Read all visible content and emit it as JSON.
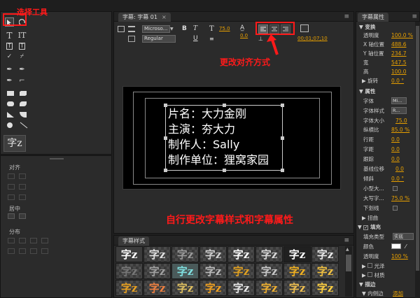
{
  "annotations": {
    "select_tool": "选择工具",
    "align_mode": "更改对齐方式",
    "style_hint": "自行更改字幕样式和字幕属性"
  },
  "title_panel": {
    "tab_label": "字幕: 字幕 01",
    "font_family": "Microso...",
    "font_style": "Regular",
    "font_size": "75.0",
    "kerning": "0.0",
    "timecode": "00;01;07;10",
    "caption_lines": [
      "片名：大力金刚",
      "主演：夯大力",
      "制作人：Sally",
      "制作单位：狸窝家园"
    ]
  },
  "tools_panel": {
    "type_tool_preview": "字z",
    "align_label": "对齐",
    "center_label": "居中",
    "distribute_label": "分布"
  },
  "styles_panel": {
    "tab_label": "字幕样式",
    "thumb_glyph": "字z"
  },
  "properties_panel": {
    "tab_label": "字幕属性",
    "transform_header": "变换",
    "opacity_label": "透明度",
    "opacity_value": "100.0 %",
    "x_label": "X 轴位置",
    "x_value": "488.6",
    "y_label": "Y 轴位置",
    "y_value": "234.7",
    "width_label": "宽",
    "width_value": "547.5",
    "height_label": "高",
    "height_value": "100.0",
    "rotation_label": "旋转",
    "rotation_value": "0.0 °",
    "attributes_header": "属性",
    "font_label": "字体",
    "font_value": "Mi...",
    "font_style_label": "字体样式",
    "font_style_value": "R...",
    "font_size_label": "字体大小",
    "font_size_value": "75.0",
    "aspect_label": "纵横比",
    "aspect_value": "85.0 %",
    "leading_label": "行距",
    "leading_value": "0.0",
    "kerning_label": "字距",
    "kerning_value": "0.0",
    "tracking_label": "跟踪",
    "tracking_value": "0.0",
    "baseline_label": "基线位移",
    "baseline_value": "0.0",
    "slant_label": "倾斜",
    "slant_value": "0.0 °",
    "smallcaps_label": "小型大...",
    "smallcaps_size_label": "大写字...",
    "smallcaps_size_value": "75.0 %",
    "underline_label": "下划线",
    "distort_label": "扭曲",
    "fill_header": "填充",
    "fill_type_label": "填充类型",
    "fill_type_value": "实底",
    "color_label": "颜色",
    "fill_opacity_label": "透明度",
    "fill_opacity_value": "100 %",
    "sheen_label": "光泽",
    "texture_label": "材质",
    "stroke_header": "描边",
    "inner_stroke_label": "内侧边",
    "add_label": "添加"
  },
  "colors": {
    "annotation": "#ff1a1a",
    "value_orange": "#e8a000",
    "panel_bg": "#2b2b2b"
  }
}
